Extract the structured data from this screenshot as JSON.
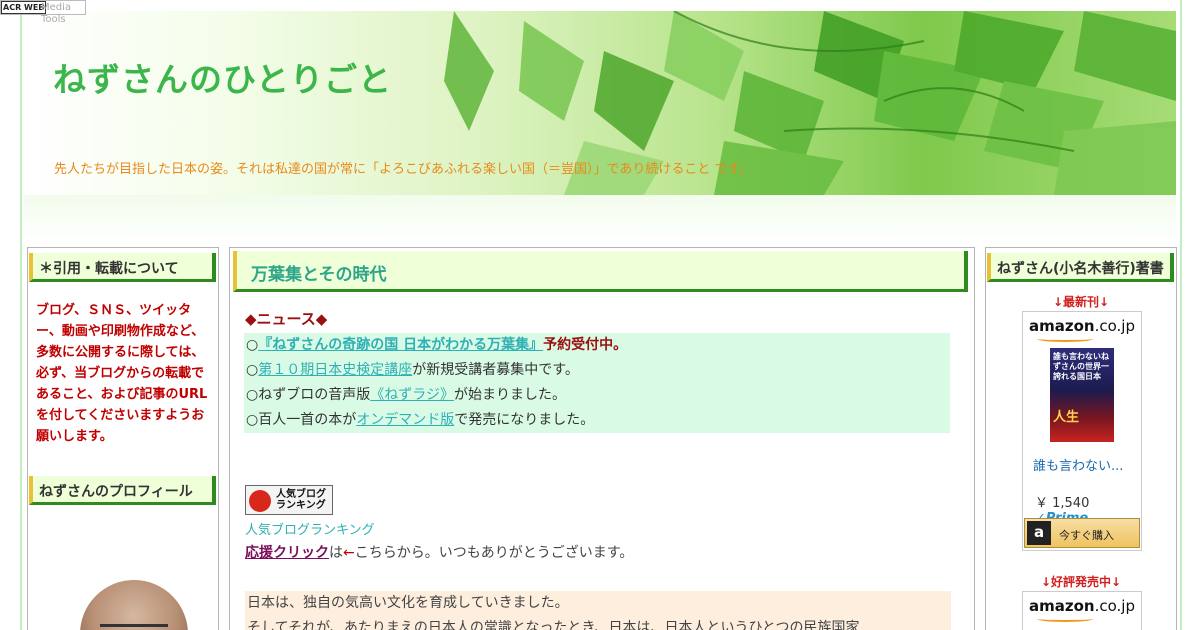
{
  "toolbar": {
    "badge": "ACR WEB",
    "label": "Media Tools"
  },
  "header": {
    "title": "ねずさんのひとりごと",
    "description": "先人たちが目指した日本の姿。それは私達の国が常に「よろこびあふれる楽しい国（＝豈国）」であり続けること です。"
  },
  "left_sidebar": {
    "section1_title": "＊引用・転載について",
    "notice": "ブログ、ＳＮＳ、ツイッター、動画や印刷物作成など、多数に公開するに際しては、必ず、当ブログからの転載であること、および記事のURLを付してくださいますようお願いします。",
    "section2_title": "ねずさんのプロフィール"
  },
  "main": {
    "post_title": "万葉集とその時代",
    "news_heading": "◆ニュース◆",
    "news": [
      {
        "prefix": "○",
        "link": "『ねずさんの奇跡の国 日本がわかる万葉集』",
        "suffix": "予約受付中。"
      },
      {
        "prefix": "○",
        "link": "第１０期日本史検定講座",
        "suffix": "が新規受講者募集中です。"
      },
      {
        "prefix": "○ねずブロの音声版",
        "link": "《ねずラジ》",
        "suffix": "が始まりました。"
      },
      {
        "prefix": "○百人一首の本が",
        "link": "オンデマンド版",
        "suffix": "で発売になりました。"
      }
    ],
    "ranking_banner": {
      "line1": "人気ブログ",
      "line2": "ランキング"
    },
    "ranking_link": "人気ブログランキング",
    "support_link": "応援クリック",
    "support_mid": "は",
    "support_arrow": "←",
    "support_rest": "こちらから。いつもありがとうございます。",
    "intro_lines": [
      "日本は、独自の気高い文化を育成していきました。",
      "そしてそれが、あたりまえの日本人の常識となったとき、日本は、日本人というひとつの民族国家"
    ]
  },
  "right_sidebar": {
    "title": "ねずさん(小名木善行)著書",
    "latest_label": "↓最新刊↓",
    "amazon_logo": "amazon",
    "amazon_tld": ".co.jp",
    "book": {
      "cover_text": "誰も言わないねずさんの世界一誇れる国日本",
      "cover_tagline": "人生",
      "title": "誰も言わない...",
      "price": "￥ 1,540",
      "prime": "✓Prime",
      "buy_icon": "a",
      "buy_label": "今すぐ購入"
    },
    "bestseller_label": "↓好評発売中↓"
  },
  "colors": {
    "title_green": "#3cb64b",
    "desc_orange": "#e88a1b",
    "heading_bg": "#efffd8",
    "news_bg": "#d9fbe5",
    "intro_bg": "#fdeede",
    "link": "#2eb0b5",
    "notice_red": "#c00000"
  }
}
